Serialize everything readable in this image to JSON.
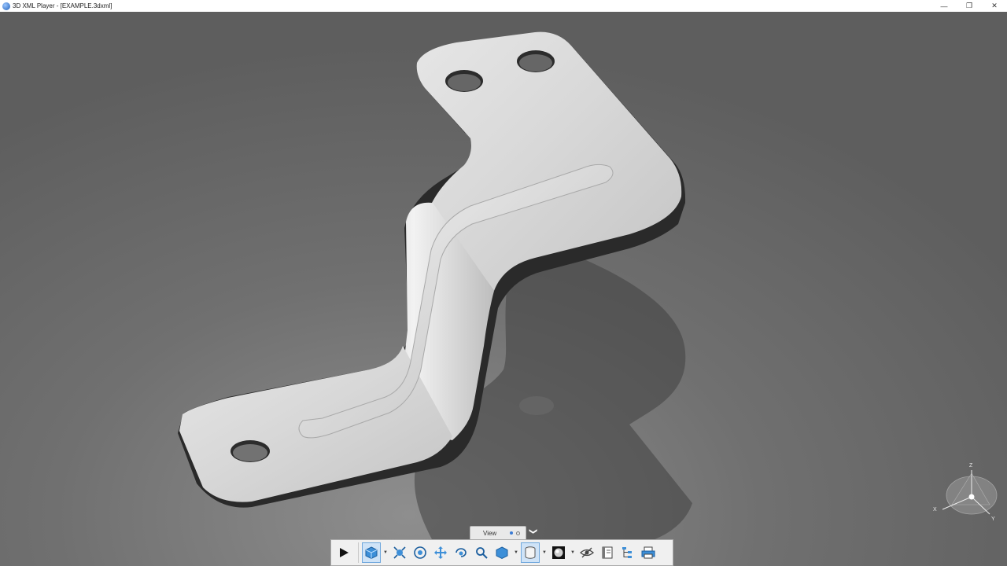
{
  "window": {
    "title": "3D XML Player - [EXAMPLE.3dxml]",
    "minimize_glyph": "—",
    "restore_glyph": "❐",
    "close_glyph": "✕"
  },
  "viewer": {
    "model": "sheet-metal bracket with three holes and a stiffening rib",
    "compass_axes": {
      "x": "X",
      "y": "Y",
      "z": "Z"
    }
  },
  "view_tab": {
    "label": "View",
    "expand_glyph": "❯"
  },
  "toolbar": {
    "items": [
      {
        "icon": "play-icon"
      },
      {
        "icon": "cube-view-icon",
        "selected": true,
        "dropdown": true
      },
      {
        "icon": "fit-all-icon"
      },
      {
        "icon": "target-icon"
      },
      {
        "icon": "pan-icon"
      },
      {
        "icon": "rotate-icon"
      },
      {
        "icon": "zoom-icon"
      },
      {
        "icon": "iso-view-icon",
        "dropdown": true
      },
      {
        "icon": "cylinder-icon",
        "selected": true,
        "dropdown": true
      },
      {
        "icon": "shading-sphere-icon",
        "dropdown": true
      },
      {
        "icon": "hide-show-icon"
      },
      {
        "icon": "book-icon"
      },
      {
        "icon": "tree-icon"
      },
      {
        "icon": "print-icon"
      }
    ]
  }
}
